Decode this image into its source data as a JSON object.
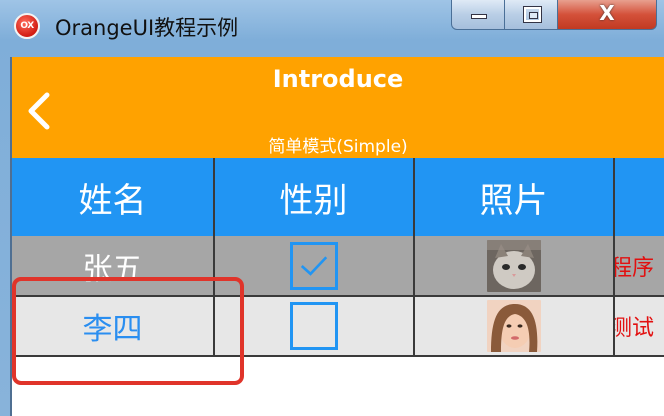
{
  "window": {
    "title": "OrangeUI教程示例",
    "app_icon_text": "OX",
    "close_glyph": "X"
  },
  "header": {
    "title": "Introduce",
    "subtitle": "简单模式(Simple)",
    "back_icon": "chevron-left-icon",
    "background": "#ffa200"
  },
  "table": {
    "columns": [
      "姓名",
      "性别",
      "照片"
    ],
    "header_color": "#2195f3",
    "rows": [
      {
        "name": "张五",
        "checked": true,
        "photo": "cat-photo",
        "extra": "程序"
      },
      {
        "name": "李四",
        "checked": false,
        "photo": "person-photo",
        "extra": "测试"
      }
    ]
  },
  "colors": {
    "accent": "#2195f3",
    "selected_row": "#a6a6a6",
    "highlight": "#e0342a",
    "extra_text": "#e21010"
  }
}
